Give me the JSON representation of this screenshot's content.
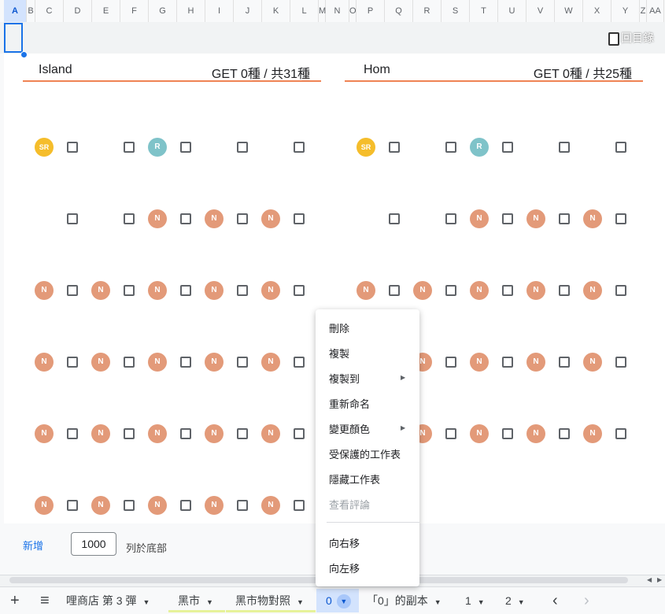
{
  "columns": [
    "A",
    "B",
    "C",
    "D",
    "E",
    "F",
    "G",
    "H",
    "I",
    "J",
    "K",
    "L",
    "M",
    "N",
    "O",
    "P",
    "Q",
    "R",
    "S",
    "T",
    "U",
    "V",
    "W",
    "X",
    "Y",
    "Z",
    "AA"
  ],
  "selected_column": "A",
  "toolbar": {
    "clipboard_label": "回目錄"
  },
  "sections": [
    {
      "name": "Island",
      "count": "GET 0種 / 共31種"
    },
    {
      "name": "Hom",
      "count": "GET 0種 / 共25種"
    }
  ],
  "badges": {
    "n": "N",
    "r": "R",
    "sr": "SR"
  },
  "grid": {
    "left": [
      [
        "sr",
        "cb",
        "",
        "cb",
        "r",
        "cb",
        "",
        "cb",
        "",
        "cb"
      ],
      [
        "",
        "cb",
        "",
        "cb",
        "n",
        "cb",
        "n",
        "cb",
        "n",
        "cb"
      ],
      [
        "n",
        "cb",
        "n",
        "cb",
        "n",
        "cb",
        "n",
        "cb",
        "n",
        "cb"
      ],
      [
        "n",
        "cb",
        "n",
        "cb",
        "n",
        "cb",
        "n",
        "cb",
        "n",
        "cb"
      ],
      [
        "n",
        "cb",
        "n",
        "cb",
        "n",
        "cb",
        "n",
        "cb",
        "n",
        "cb"
      ],
      [
        "n",
        "cb",
        "n",
        "cb",
        "n",
        "cb",
        "n",
        "cb",
        "n",
        "cb"
      ]
    ],
    "right": [
      [
        "sr",
        "cb",
        "",
        "cb",
        "r",
        "cb",
        "",
        "cb",
        "",
        "cb"
      ],
      [
        "",
        "cb",
        "",
        "cb",
        "n",
        "cb",
        "n",
        "cb",
        "n",
        "cb"
      ],
      [
        "n",
        "cb",
        "n",
        "cb",
        "n",
        "cb",
        "n",
        "cb",
        "n",
        "cb"
      ],
      [
        "",
        "",
        "n",
        "cb",
        "n",
        "cb",
        "n",
        "cb",
        "n",
        "cb"
      ],
      [
        "",
        "",
        "n",
        "cb",
        "n",
        "cb",
        "n",
        "cb",
        "n",
        "cb"
      ],
      [
        "",
        "",
        "",
        "",
        "",
        "",
        "",
        "",
        "",
        ""
      ]
    ]
  },
  "add_rows": {
    "link": "新增",
    "value": "1000",
    "suffix": "列於底部"
  },
  "tabs": [
    {
      "label": "哩商店 第 3 彈"
    },
    {
      "label": "黑市"
    },
    {
      "label": "黑市物對照"
    },
    {
      "label": "0"
    },
    {
      "label": "「0」的副本"
    },
    {
      "label": "1"
    },
    {
      "label": "2"
    }
  ],
  "icons": {
    "add": "+",
    "all_sheets": "≡",
    "prev": "‹",
    "next": "›",
    "submenu": "▶",
    "caret": "▼"
  },
  "context_menu": {
    "items": [
      "刪除",
      "複製",
      "複製到",
      "重新命名",
      "變更顏色",
      "受保護的工作表",
      "隱藏工作表",
      "查看評論"
    ],
    "items_after_sep": [
      "向右移",
      "向左移"
    ]
  }
}
